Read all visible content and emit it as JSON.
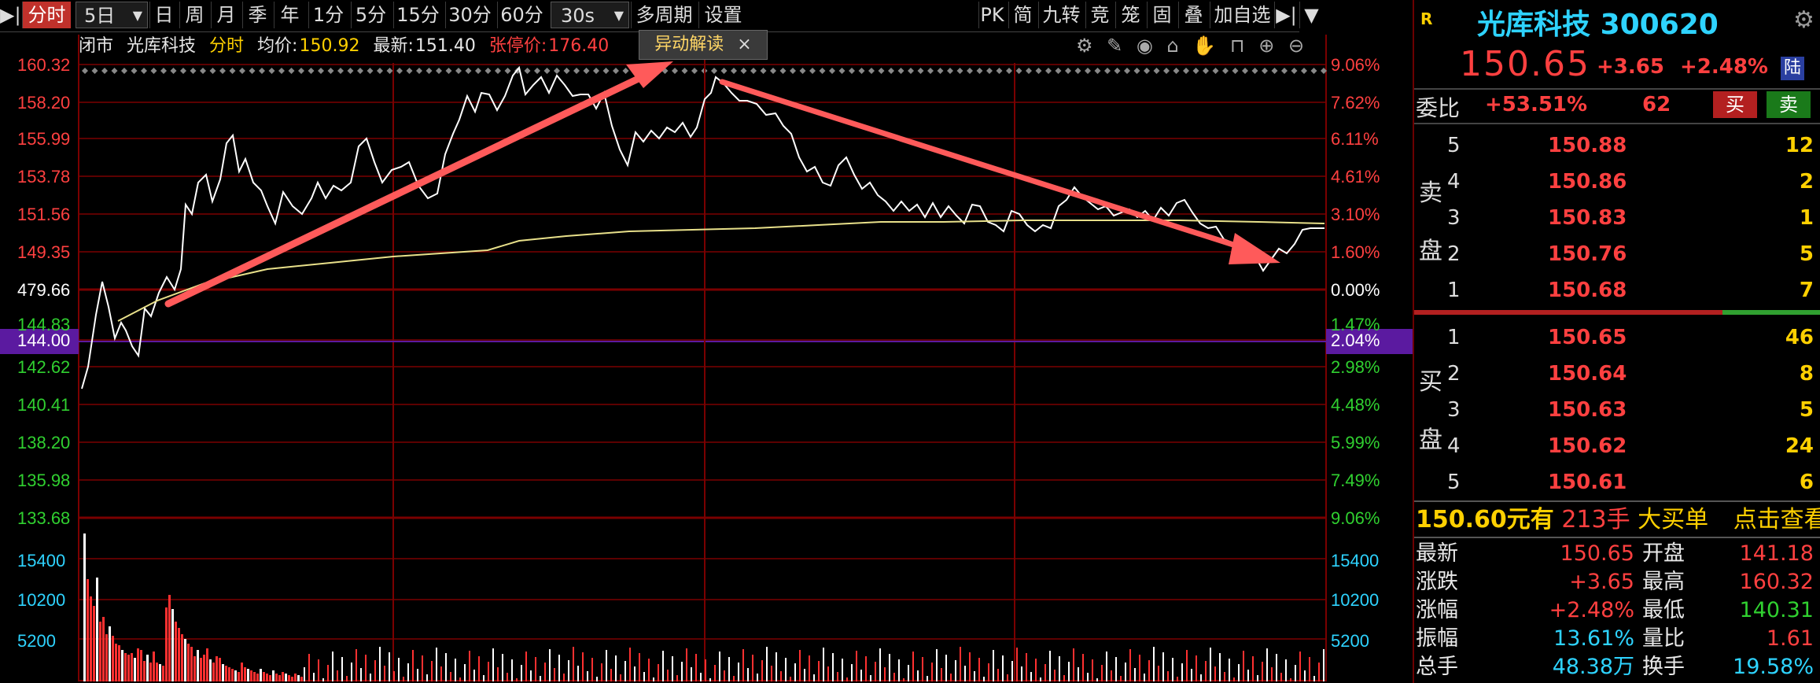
{
  "toolbar": {
    "left_icon": "▶|",
    "items": [
      "分时",
      "5日",
      "日",
      "周",
      "月",
      "季",
      "年",
      "1分",
      "5分",
      "15分",
      "30分",
      "60分",
      "30s",
      "多周期",
      "设置"
    ],
    "active_index": 0,
    "right_items": [
      "PK",
      "简",
      "九转",
      "竞",
      "笼",
      "固",
      "叠",
      "加自选"
    ],
    "end_icon": "▶|"
  },
  "infobar": {
    "status": "闭市",
    "name": "光库科技",
    "mode": "分时",
    "avg_label": "均价:",
    "avg_value": "150.92",
    "latest_label": "最新:",
    "latest_value": "151.40",
    "limit_label": "张停价:",
    "limit_value": "176.40",
    "anomaly_button": "异动解读",
    "anomaly_close": "×"
  },
  "chart": {
    "left_axis": [
      "160.32",
      "158.20",
      "155.99",
      "153.78",
      "151.56",
      "149.35",
      "479.66",
      "144.00",
      "142.62",
      "140.41",
      "138.20",
      "135.98",
      "133.68"
    ],
    "right_axis": [
      "9.06%",
      "7.62%",
      "6.11%",
      "4.61%",
      "3.10%",
      "1.60%",
      "0.00%",
      "2.04%",
      "2.98%",
      "4.48%",
      "5.99%",
      "7.49%",
      "9.06%"
    ],
    "volume_left": [
      "15400",
      "10200",
      "5200"
    ],
    "volume_right": [
      "15400",
      "10200",
      "5200"
    ],
    "right_axis_partial": "1.47%",
    "left_axis_partial": "144.83",
    "colors": {
      "grid": "#7a0000",
      "price": "#ffffff",
      "avg": "#e8e08a",
      "arrow": "#ff5a5a",
      "up": "#ff3030",
      "down": "#30d030"
    }
  },
  "quote": {
    "flag": "R",
    "name": "光库科技",
    "code": "300620",
    "price": "150.65",
    "change": "+3.65",
    "change_pct": "+2.48%",
    "market": "陆",
    "ratio_label": "委比",
    "ratio_value": "+53.51%",
    "ratio_diff": "62",
    "buy_btn": "买",
    "sell_btn": "卖",
    "sell_label": [
      "卖",
      "盘"
    ],
    "buy_label": [
      "买",
      "盘"
    ],
    "asks": [
      {
        "level": "5",
        "price": "150.88",
        "vol": "12"
      },
      {
        "level": "4",
        "price": "150.86",
        "vol": "2"
      },
      {
        "level": "3",
        "price": "150.83",
        "vol": "1"
      },
      {
        "level": "2",
        "price": "150.76",
        "vol": "5"
      },
      {
        "level": "1",
        "price": "150.68",
        "vol": "7"
      }
    ],
    "bids": [
      {
        "level": "1",
        "price": "150.65",
        "vol": "46"
      },
      {
        "level": "2",
        "price": "150.64",
        "vol": "8"
      },
      {
        "level": "3",
        "price": "150.63",
        "vol": "5"
      },
      {
        "level": "4",
        "price": "150.62",
        "vol": "24"
      },
      {
        "level": "5",
        "price": "150.61",
        "vol": "6"
      }
    ],
    "big_order": {
      "price": "150.60元有",
      "qty": "213手",
      "label": "大买单",
      "link": "点击查看"
    },
    "stats": [
      {
        "k1": "最新",
        "v1": "150.65",
        "k2": "开盘",
        "v2": "141.18"
      },
      {
        "k1": "涨跌",
        "v1": "+3.65",
        "k2": "最高",
        "v2": "160.32"
      },
      {
        "k1": "涨幅",
        "v1": "+2.48%",
        "k2": "最低",
        "v2": "140.31"
      },
      {
        "k1": "振幅",
        "v1": "13.61%",
        "k2": "量比",
        "v2": "1.61"
      },
      {
        "k1": "总手",
        "v1": "48.38万",
        "k2": "换手",
        "v2": "19.58%"
      }
    ]
  }
}
